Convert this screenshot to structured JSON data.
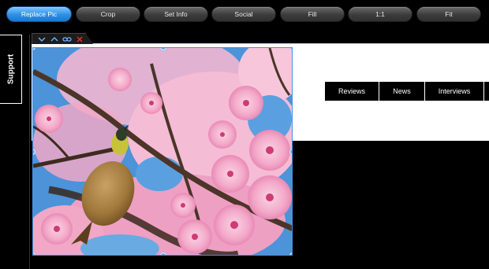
{
  "toolbar": {
    "buttons": [
      {
        "label": "Replace Pic",
        "active": true
      },
      {
        "label": "Crop"
      },
      {
        "label": "Set Info"
      },
      {
        "label": "Social"
      },
      {
        "label": "Fill"
      },
      {
        "label": "1:1"
      },
      {
        "label": "Fit"
      }
    ]
  },
  "support_tab": {
    "label": "Support"
  },
  "mini_toolbar": {
    "icons": [
      "chevron-down-icon",
      "chevron-up-icon",
      "link-icon",
      "close-icon"
    ]
  },
  "nav": {
    "items": [
      {
        "label": "Reviews"
      },
      {
        "label": "News"
      },
      {
        "label": "Interviews"
      }
    ]
  },
  "image": {
    "subject": "bird-on-cherry-blossom-branch",
    "colors": {
      "sky": "#4c93d9",
      "blossom": "#f3a9c9",
      "blossom_dark": "#d13a74",
      "branch": "#4a3528"
    }
  },
  "colors": {
    "accent": "#2d8fe3",
    "toolbar_button": "#3c3c3c",
    "selection": "#4a8fe0",
    "close": "#e0312b"
  }
}
